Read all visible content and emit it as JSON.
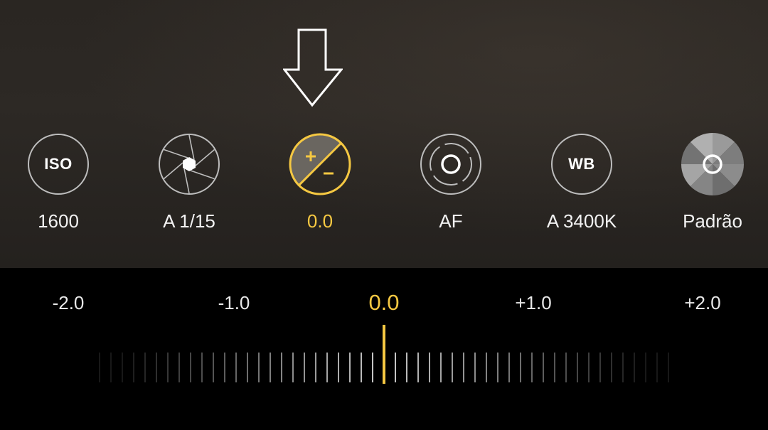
{
  "colors": {
    "accent": "#f5c842",
    "ring": "#bdbdbd",
    "text": "#f2f2f2",
    "panel": "#000000"
  },
  "controls": [
    {
      "id": "iso",
      "icon": "iso-icon",
      "icon_text": "ISO",
      "value": "1600",
      "active": false
    },
    {
      "id": "shutter",
      "icon": "aperture-shutter-icon",
      "icon_text": "",
      "value": "A 1/15",
      "active": false
    },
    {
      "id": "exposure",
      "icon": "exposure-compensation-icon",
      "icon_text": "",
      "value": "0.0",
      "active": true
    },
    {
      "id": "focus",
      "icon": "focus-icon",
      "icon_text": "",
      "value": "AF",
      "active": false
    },
    {
      "id": "white_balance",
      "icon": "wb-icon",
      "icon_text": "WB",
      "value": "A 3400K",
      "active": false
    },
    {
      "id": "style",
      "icon": "color-style-icon",
      "icon_text": "",
      "value": "Padrão",
      "active": false
    }
  ],
  "exposure_scale": {
    "labels": [
      "-2.0",
      "-1.0",
      "0.0",
      "+1.0",
      "+2.0"
    ],
    "current_value": 0.0,
    "min": -2.0,
    "max": 2.0,
    "step": 0.1
  },
  "overlay": {
    "pointer": "down-arrow-icon"
  }
}
